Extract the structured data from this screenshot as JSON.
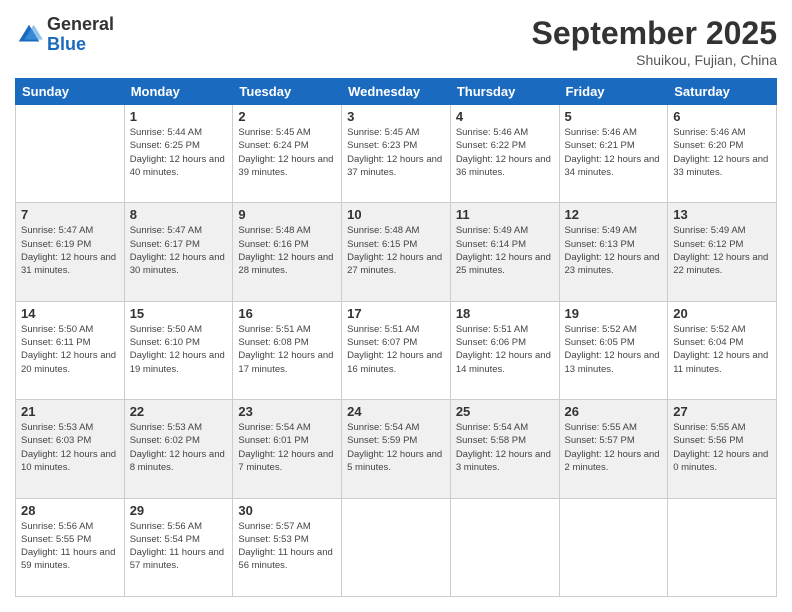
{
  "logo": {
    "general": "General",
    "blue": "Blue"
  },
  "header": {
    "month": "September 2025",
    "location": "Shuikou, Fujian, China"
  },
  "days_of_week": [
    "Sunday",
    "Monday",
    "Tuesday",
    "Wednesday",
    "Thursday",
    "Friday",
    "Saturday"
  ],
  "weeks": [
    [
      {
        "day": "",
        "sunrise": "",
        "sunset": "",
        "daylight": ""
      },
      {
        "day": "1",
        "sunrise": "Sunrise: 5:44 AM",
        "sunset": "Sunset: 6:25 PM",
        "daylight": "Daylight: 12 hours and 40 minutes."
      },
      {
        "day": "2",
        "sunrise": "Sunrise: 5:45 AM",
        "sunset": "Sunset: 6:24 PM",
        "daylight": "Daylight: 12 hours and 39 minutes."
      },
      {
        "day": "3",
        "sunrise": "Sunrise: 5:45 AM",
        "sunset": "Sunset: 6:23 PM",
        "daylight": "Daylight: 12 hours and 37 minutes."
      },
      {
        "day": "4",
        "sunrise": "Sunrise: 5:46 AM",
        "sunset": "Sunset: 6:22 PM",
        "daylight": "Daylight: 12 hours and 36 minutes."
      },
      {
        "day": "5",
        "sunrise": "Sunrise: 5:46 AM",
        "sunset": "Sunset: 6:21 PM",
        "daylight": "Daylight: 12 hours and 34 minutes."
      },
      {
        "day": "6",
        "sunrise": "Sunrise: 5:46 AM",
        "sunset": "Sunset: 6:20 PM",
        "daylight": "Daylight: 12 hours and 33 minutes."
      }
    ],
    [
      {
        "day": "7",
        "sunrise": "Sunrise: 5:47 AM",
        "sunset": "Sunset: 6:19 PM",
        "daylight": "Daylight: 12 hours and 31 minutes."
      },
      {
        "day": "8",
        "sunrise": "Sunrise: 5:47 AM",
        "sunset": "Sunset: 6:17 PM",
        "daylight": "Daylight: 12 hours and 30 minutes."
      },
      {
        "day": "9",
        "sunrise": "Sunrise: 5:48 AM",
        "sunset": "Sunset: 6:16 PM",
        "daylight": "Daylight: 12 hours and 28 minutes."
      },
      {
        "day": "10",
        "sunrise": "Sunrise: 5:48 AM",
        "sunset": "Sunset: 6:15 PM",
        "daylight": "Daylight: 12 hours and 27 minutes."
      },
      {
        "day": "11",
        "sunrise": "Sunrise: 5:49 AM",
        "sunset": "Sunset: 6:14 PM",
        "daylight": "Daylight: 12 hours and 25 minutes."
      },
      {
        "day": "12",
        "sunrise": "Sunrise: 5:49 AM",
        "sunset": "Sunset: 6:13 PM",
        "daylight": "Daylight: 12 hours and 23 minutes."
      },
      {
        "day": "13",
        "sunrise": "Sunrise: 5:49 AM",
        "sunset": "Sunset: 6:12 PM",
        "daylight": "Daylight: 12 hours and 22 minutes."
      }
    ],
    [
      {
        "day": "14",
        "sunrise": "Sunrise: 5:50 AM",
        "sunset": "Sunset: 6:11 PM",
        "daylight": "Daylight: 12 hours and 20 minutes."
      },
      {
        "day": "15",
        "sunrise": "Sunrise: 5:50 AM",
        "sunset": "Sunset: 6:10 PM",
        "daylight": "Daylight: 12 hours and 19 minutes."
      },
      {
        "day": "16",
        "sunrise": "Sunrise: 5:51 AM",
        "sunset": "Sunset: 6:08 PM",
        "daylight": "Daylight: 12 hours and 17 minutes."
      },
      {
        "day": "17",
        "sunrise": "Sunrise: 5:51 AM",
        "sunset": "Sunset: 6:07 PM",
        "daylight": "Daylight: 12 hours and 16 minutes."
      },
      {
        "day": "18",
        "sunrise": "Sunrise: 5:51 AM",
        "sunset": "Sunset: 6:06 PM",
        "daylight": "Daylight: 12 hours and 14 minutes."
      },
      {
        "day": "19",
        "sunrise": "Sunrise: 5:52 AM",
        "sunset": "Sunset: 6:05 PM",
        "daylight": "Daylight: 12 hours and 13 minutes."
      },
      {
        "day": "20",
        "sunrise": "Sunrise: 5:52 AM",
        "sunset": "Sunset: 6:04 PM",
        "daylight": "Daylight: 12 hours and 11 minutes."
      }
    ],
    [
      {
        "day": "21",
        "sunrise": "Sunrise: 5:53 AM",
        "sunset": "Sunset: 6:03 PM",
        "daylight": "Daylight: 12 hours and 10 minutes."
      },
      {
        "day": "22",
        "sunrise": "Sunrise: 5:53 AM",
        "sunset": "Sunset: 6:02 PM",
        "daylight": "Daylight: 12 hours and 8 minutes."
      },
      {
        "day": "23",
        "sunrise": "Sunrise: 5:54 AM",
        "sunset": "Sunset: 6:01 PM",
        "daylight": "Daylight: 12 hours and 7 minutes."
      },
      {
        "day": "24",
        "sunrise": "Sunrise: 5:54 AM",
        "sunset": "Sunset: 5:59 PM",
        "daylight": "Daylight: 12 hours and 5 minutes."
      },
      {
        "day": "25",
        "sunrise": "Sunrise: 5:54 AM",
        "sunset": "Sunset: 5:58 PM",
        "daylight": "Daylight: 12 hours and 3 minutes."
      },
      {
        "day": "26",
        "sunrise": "Sunrise: 5:55 AM",
        "sunset": "Sunset: 5:57 PM",
        "daylight": "Daylight: 12 hours and 2 minutes."
      },
      {
        "day": "27",
        "sunrise": "Sunrise: 5:55 AM",
        "sunset": "Sunset: 5:56 PM",
        "daylight": "Daylight: 12 hours and 0 minutes."
      }
    ],
    [
      {
        "day": "28",
        "sunrise": "Sunrise: 5:56 AM",
        "sunset": "Sunset: 5:55 PM",
        "daylight": "Daylight: 11 hours and 59 minutes."
      },
      {
        "day": "29",
        "sunrise": "Sunrise: 5:56 AM",
        "sunset": "Sunset: 5:54 PM",
        "daylight": "Daylight: 11 hours and 57 minutes."
      },
      {
        "day": "30",
        "sunrise": "Sunrise: 5:57 AM",
        "sunset": "Sunset: 5:53 PM",
        "daylight": "Daylight: 11 hours and 56 minutes."
      },
      {
        "day": "",
        "sunrise": "",
        "sunset": "",
        "daylight": ""
      },
      {
        "day": "",
        "sunrise": "",
        "sunset": "",
        "daylight": ""
      },
      {
        "day": "",
        "sunrise": "",
        "sunset": "",
        "daylight": ""
      },
      {
        "day": "",
        "sunrise": "",
        "sunset": "",
        "daylight": ""
      }
    ]
  ]
}
